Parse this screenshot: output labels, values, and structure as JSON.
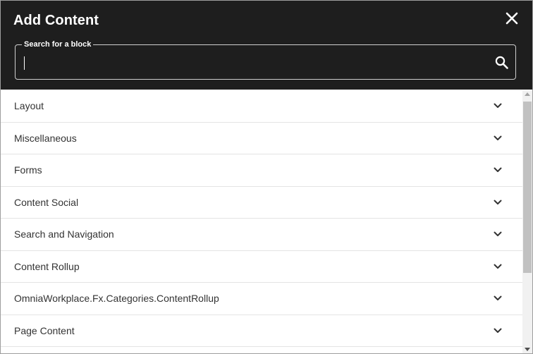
{
  "dialog": {
    "title": "Add Content",
    "close_icon": "close-icon"
  },
  "search": {
    "legend": "Search for a block",
    "value": "",
    "placeholder": "",
    "icon": "search-icon"
  },
  "categories": [
    {
      "label": "Layout"
    },
    {
      "label": "Miscellaneous"
    },
    {
      "label": "Forms"
    },
    {
      "label": "Content Social"
    },
    {
      "label": "Search and Navigation"
    },
    {
      "label": "Content Rollup"
    },
    {
      "label": "OmniaWorkplace.Fx.Categories.ContentRollup"
    },
    {
      "label": "Page Content"
    }
  ],
  "colors": {
    "header_bg": "#1e1e1e",
    "text": "#333333",
    "divider": "#e4e4e4"
  }
}
